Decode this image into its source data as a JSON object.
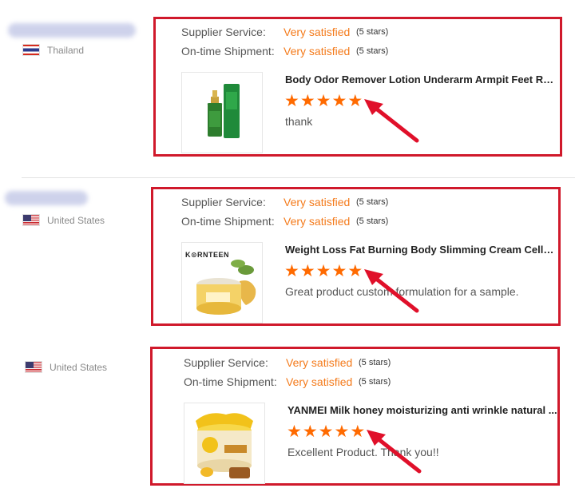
{
  "reviews": [
    {
      "country": "Thailand",
      "flag": "thailand-flag-icon",
      "supplier_label": "Supplier Service:",
      "supplier_value": "Very satisfied",
      "supplier_stars": "(5 stars)",
      "shipment_label": "On-time Shipment:",
      "shipment_value": "Very satisfied",
      "shipment_stars": "(5 stars)",
      "product_title": "Body Odor Remover Lotion Underarm Armpit Feet Ref...",
      "rating": 5,
      "comment": "thank",
      "product_icon": "serum-bottle-icon"
    },
    {
      "country": "United States",
      "flag": "usa-flag-icon",
      "supplier_label": "Supplier Service:",
      "supplier_value": "Very satisfied",
      "supplier_stars": "(5 stars)",
      "shipment_label": "On-time Shipment:",
      "shipment_value": "Very satisfied",
      "shipment_stars": "(5 stars)",
      "product_title": "Weight Loss Fat Burning Body Slimming Cream Celluli...",
      "rating": 5,
      "comment": "Great product custom formulation for a sample.",
      "product_icon": "cream-jar-icon",
      "product_brand": "K⊙RNTEEN"
    },
    {
      "country": "United States",
      "flag": "usa-flag-icon",
      "supplier_label": "Supplier Service:",
      "supplier_value": "Very satisfied",
      "supplier_stars": "(5 stars)",
      "shipment_label": "On-time Shipment:",
      "shipment_value": "Very satisfied",
      "shipment_stars": "(5 stars)",
      "product_title": "YANMEI Milk honey moisturizing anti wrinkle natural ...",
      "rating": 5,
      "comment": "Excellent Product.  Thank you!!",
      "product_icon": "honey-mask-jar-icon"
    }
  ],
  "star_glyph": "★",
  "colors": {
    "accent": "#f47b1c",
    "star": "#ff6a00",
    "highlight_box": "#d0192b",
    "arrow": "#e0102a"
  }
}
